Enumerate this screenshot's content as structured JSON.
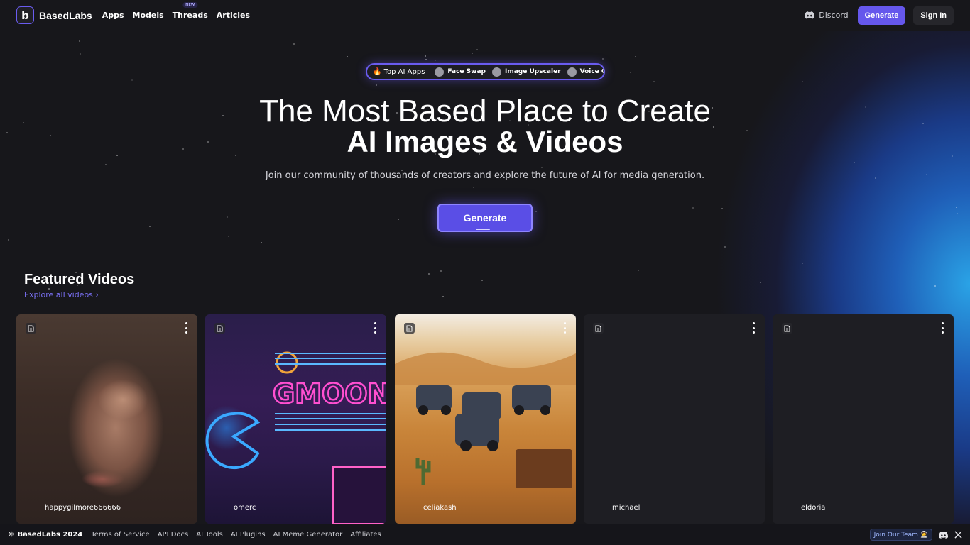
{
  "brand": {
    "name": "BasedLabs"
  },
  "nav": {
    "items": [
      {
        "label": "Apps"
      },
      {
        "label": "Models"
      },
      {
        "label": "Threads",
        "badge": "NEW"
      },
      {
        "label": "Articles"
      }
    ]
  },
  "header": {
    "discord_label": "Discord",
    "generate_label": "Generate",
    "signin_label": "Sign In"
  },
  "top_apps": {
    "label": "🔥 Top AI Apps",
    "apps": [
      {
        "label": "Face Swap"
      },
      {
        "label": "Image Upscaler"
      },
      {
        "label": "Voice Clone"
      }
    ]
  },
  "hero": {
    "title_line1": "The Most Based Place to Create",
    "title_line2": "AI Images & Videos",
    "subtitle": "Join our community of thousands of creators and explore the future of AI for media generation.",
    "cta_label": "Generate"
  },
  "featured": {
    "title": "Featured Videos",
    "explore_label": "Explore all videos",
    "cards": [
      {
        "user": "happygilmore666666"
      },
      {
        "user": "omerc"
      },
      {
        "user": "celiakash"
      },
      {
        "user": "michael"
      },
      {
        "user": "eldoria"
      }
    ]
  },
  "footer": {
    "copyright": "© BasedLabs 2024",
    "links": [
      {
        "label": "Terms of Service"
      },
      {
        "label": "API Docs"
      },
      {
        "label": "AI Tools"
      },
      {
        "label": "AI Plugins"
      },
      {
        "label": "AI Meme Generator"
      },
      {
        "label": "Affiliates"
      }
    ],
    "join_label": "Join Our Team 🧑‍🚀"
  },
  "colors": {
    "accent": "#6557ec",
    "background": "#17171b",
    "link": "#7a70f5"
  },
  "icons": [
    "discord-icon",
    "x-icon",
    "file-icon",
    "more-vertical-icon",
    "chevron-right-icon"
  ]
}
